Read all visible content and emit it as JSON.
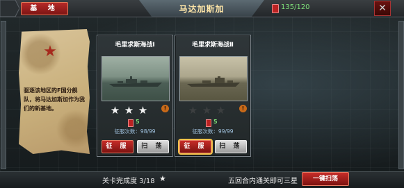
{
  "header": {
    "base_label": "基 地",
    "title": "马达加斯加",
    "energy": "135/120"
  },
  "briefing": {
    "text": "驱逐该地区的F国分舰队，将马达加斯加作为我们的新基地。",
    "emblem_icon": "red-star-icon"
  },
  "missions": [
    {
      "title": "毛里求斯海战Ⅰ",
      "stars_total": 3,
      "stars_earned": 3,
      "energy_cost": "5",
      "attempts": "征服次数：98/99",
      "conquer_label": "征 服",
      "sweep_label": "扫 荡",
      "selected": false
    },
    {
      "title": "毛里求斯海战Ⅱ",
      "stars_total": 3,
      "stars_earned": 0,
      "energy_cost": "5",
      "attempts": "征服次数：99/99",
      "conquer_label": "征 服",
      "sweep_label": "扫 荡",
      "selected": true
    }
  ],
  "footer": {
    "progress": "关卡完成度 3/18",
    "hint": "五回合内通关即可三星",
    "one_click_sweep": "一键扫荡"
  },
  "colors": {
    "accent_red": "#c62d29",
    "energy_green": "#7fe07a",
    "title_gold": "#ffe6a8"
  }
}
